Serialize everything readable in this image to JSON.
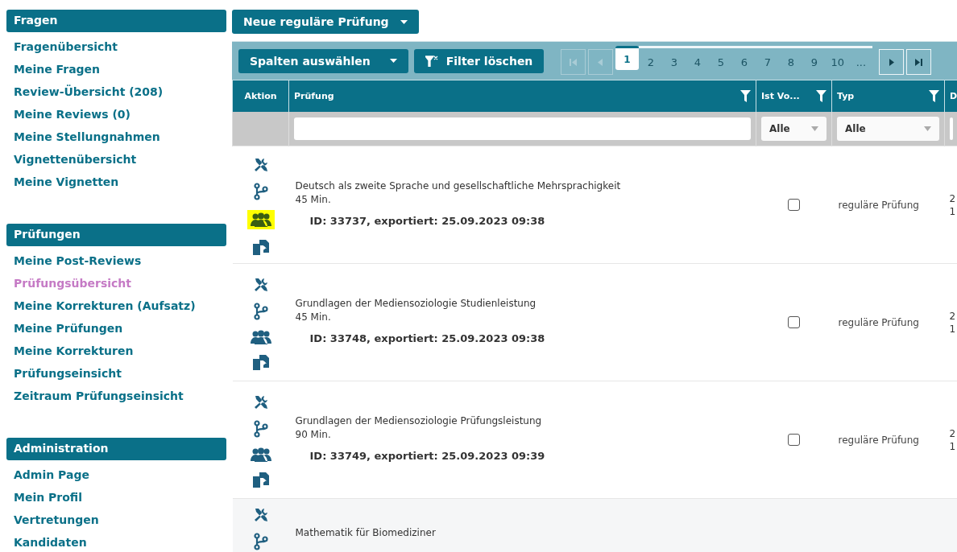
{
  "sidebar": {
    "sections": [
      {
        "title": "Fragen",
        "items": [
          {
            "label": "Fragenübersicht",
            "selected": false
          },
          {
            "label": "Meine Fragen",
            "selected": false
          },
          {
            "label": "Review-Übersicht (208)",
            "selected": false
          },
          {
            "label": "Meine Reviews (0)",
            "selected": false
          },
          {
            "label": "Meine Stellungnahmen",
            "selected": false
          },
          {
            "label": "Vignettenübersicht",
            "selected": false
          },
          {
            "label": "Meine Vignetten",
            "selected": false
          }
        ]
      },
      {
        "title": "Prüfungen",
        "items": [
          {
            "label": "Meine Post-Reviews",
            "selected": false
          },
          {
            "label": "Prüfungsübersicht",
            "selected": true
          },
          {
            "label": "Meine Korrekturen (Aufsatz)",
            "selected": false
          },
          {
            "label": "Meine Prüfungen",
            "selected": false
          },
          {
            "label": "Meine Korrekturen",
            "selected": false
          },
          {
            "label": "Prüfungseinsicht",
            "selected": false
          },
          {
            "label": "Zeitraum Prüfungseinsicht",
            "selected": false
          }
        ]
      },
      {
        "title": "Administration",
        "items": [
          {
            "label": "Admin Page",
            "selected": false
          },
          {
            "label": "Mein Profil",
            "selected": false
          },
          {
            "label": "Vertretungen",
            "selected": false
          },
          {
            "label": "Kandidaten",
            "selected": false
          }
        ]
      }
    ]
  },
  "new_exam_button": {
    "label": "Neue reguläre Prüfung"
  },
  "toolbar": {
    "columns_button": "Spalten auswählen",
    "clear_filter_button": "Filter löschen"
  },
  "pagination": {
    "first_disabled": true,
    "prev_disabled": true,
    "pages": [
      {
        "label": "1",
        "selected": true
      },
      {
        "label": "2",
        "selected": false
      },
      {
        "label": "3",
        "selected": false
      },
      {
        "label": "4",
        "selected": false
      },
      {
        "label": "5",
        "selected": false
      },
      {
        "label": "6",
        "selected": false
      },
      {
        "label": "7",
        "selected": false
      },
      {
        "label": "8",
        "selected": false
      },
      {
        "label": "9",
        "selected": false
      },
      {
        "label": "10",
        "selected": false
      }
    ],
    "more": "...",
    "next_disabled": false,
    "last_disabled": false
  },
  "table": {
    "columns": [
      {
        "label": "Aktion",
        "filterable": false
      },
      {
        "label": "Prüfung",
        "filterable": true
      },
      {
        "label": "Ist Vo...",
        "filterable": true
      },
      {
        "label": "Typ",
        "filterable": true
      },
      {
        "label": "D"
      }
    ],
    "filters": [
      {
        "kind": "none"
      },
      {
        "kind": "text"
      },
      {
        "kind": "select",
        "value": "Alle"
      },
      {
        "kind": "select",
        "value": "Alle"
      },
      {
        "kind": "text"
      }
    ],
    "rows": [
      {
        "title": "Deutsch als zweite Sprache und gesellschaftliche Mehrsprachigkeit",
        "duration": "45 Min.",
        "export": "ID: 33737, exportiert: 25.09.2023 09:38",
        "checked": false,
        "type": "reguläre Prüfung",
        "column_5": [
          "2",
          "1"
        ],
        "highlighted": true
      },
      {
        "title": "Grundlagen der Mediensoziologie Studienleistung",
        "duration": "45 Min.",
        "export": "ID: 33748, exportiert: 25.09.2023 09:38",
        "checked": false,
        "type": "reguläre Prüfung",
        "column_5": [
          "2",
          "1"
        ],
        "highlighted": false
      },
      {
        "title": "Grundlagen der Mediensoziologie Prüfungsleistung",
        "duration": "90 Min.",
        "export": "ID: 33749, exportiert: 25.09.2023 09:39",
        "checked": false,
        "type": "reguläre Prüfung",
        "column_5": [
          "2",
          "1"
        ],
        "highlighted": false
      },
      {
        "title": "Mathematik für Biomediziner"
      }
    ]
  }
}
